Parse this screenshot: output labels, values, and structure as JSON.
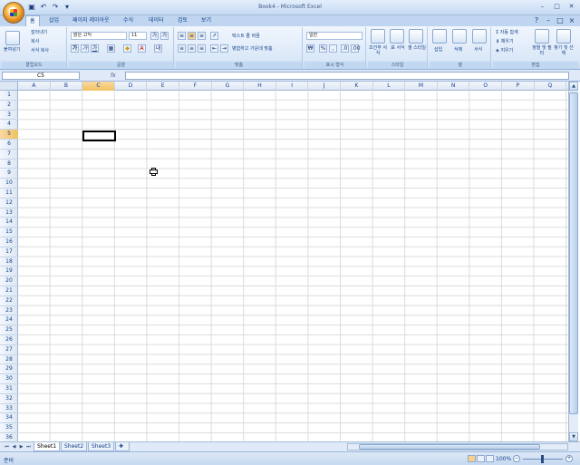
{
  "window": {
    "title": "Book4 - Microsoft Excel",
    "minimize": "–",
    "maximize": "□",
    "close": "✕"
  },
  "qat": {
    "save_icon": "save-icon",
    "undo_icon": "undo-icon",
    "redo_icon": "redo-icon",
    "customize_icon": "chevron-down-icon"
  },
  "tabs": [
    "홈",
    "삽입",
    "페이지 레이아웃",
    "수식",
    "데이터",
    "검토",
    "보기"
  ],
  "active_tab": "홈",
  "ribbon": {
    "clipboard": {
      "label": "클립보드",
      "paste": "붙여넣기",
      "cut": "잘라내기",
      "copy": "복사",
      "format_painter": "서식 복사"
    },
    "font": {
      "label": "글꼴",
      "font_name": "맑은 고딕",
      "font_size": "11",
      "bold": "가",
      "italic": "가",
      "underline": "가",
      "grow": "가",
      "shrink": "가"
    },
    "alignment": {
      "label": "맞춤",
      "wrap_text": "텍스트 줄 바꿈",
      "merge_center": "병합하고 가운데 맞춤"
    },
    "number": {
      "label": "표시 형식",
      "format": "일반",
      "currency": "₩",
      "percent": "%",
      "comma": ","
    },
    "styles": {
      "label": "스타일",
      "conditional": "조건부 서식",
      "table": "표 서식",
      "cell": "셀 스타일"
    },
    "cells": {
      "label": "셀",
      "insert": "삽입",
      "delete": "삭제",
      "format": "서식"
    },
    "editing": {
      "label": "편집",
      "autosum": "자동 합계",
      "fill": "채우기",
      "clear": "지우기",
      "sort_filter": "정렬 및 필터",
      "find_select": "찾기 및 선택"
    }
  },
  "formula_bar": {
    "name_box": "C5",
    "fx": "fx",
    "formula": ""
  },
  "grid": {
    "columns": [
      "A",
      "B",
      "C",
      "D",
      "E",
      "F",
      "G",
      "H",
      "I",
      "J",
      "K",
      "L",
      "M",
      "N",
      "O",
      "P",
      "Q"
    ],
    "rows": [
      "1",
      "2",
      "3",
      "4",
      "5",
      "6",
      "7",
      "8",
      "9",
      "10",
      "11",
      "12",
      "13",
      "14",
      "15",
      "16",
      "17",
      "18",
      "19",
      "20",
      "21",
      "22",
      "23",
      "24",
      "25",
      "26",
      "27",
      "28",
      "29",
      "30",
      "31",
      "32",
      "33",
      "34",
      "35",
      "36"
    ],
    "selected_column": "C",
    "selected_row": "5"
  },
  "sheets": [
    "Sheet1",
    "Sheet2",
    "Sheet3"
  ],
  "active_sheet": "Sheet1",
  "status": {
    "ready": "준비",
    "zoom": "100%"
  }
}
